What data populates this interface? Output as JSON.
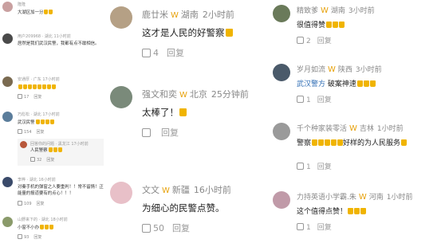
{
  "col1": [
    {
      "name": "隆隆",
      "text": "大湖区加一分",
      "emoji": 2,
      "likes": "",
      "reply": "",
      "avatar_color": "#c9a0a0"
    },
    {
      "name": "用户209968 · 湖北 11小时前",
      "text": "居然是我们武汉民警，我都有点不敢相信。",
      "emoji": 0,
      "likes": "",
      "reply": "",
      "avatar_color": "#4a4a4a"
    },
    {
      "name": "安通厚 · 广东 17小时前",
      "text": "",
      "emoji": 8,
      "likes": "17",
      "reply": "回复",
      "avatar_color": "#7a6a50"
    },
    {
      "name": "巧彪松 · 湖北 17小时前",
      "text": "武汉民警",
      "emoji": 4,
      "likes": "154",
      "reply": "回复",
      "avatar_color": "#5b7d9b",
      "sub": {
        "name": "回答你的问题 · 黑龙江 17小时前",
        "text": "人民警察",
        "emoji": 3,
        "likes": "32",
        "reply": "回复"
      }
    },
    {
      "name": "李桦 · 湖北 16小时前",
      "text": "对秦手机的弹窗之人要重判！！常不留情！正能量的报道要有的点心！！！",
      "emoji": 0,
      "likes": "109",
      "reply": "回复",
      "avatar_color": "#3a4a6a"
    },
    {
      "name": "山野来下的 · 湖北 18小时前",
      "text": "小窗不小办",
      "emoji": 3,
      "likes": "93",
      "reply": "回复",
      "avatar_color": "#8a9a6a"
    }
  ],
  "col2": [
    {
      "name": "鹿廿米",
      "region": "湖南",
      "time": "2小时前",
      "text": "这才是人民的好警察",
      "emoji": 1,
      "likes": "4",
      "reply": "回复",
      "avatar_color": "#b5a085"
    },
    {
      "name": "强文和奕",
      "region": "北京",
      "time": "25分钟前",
      "text": "太棒了！",
      "emoji": 1,
      "likes": "",
      "reply": "回复",
      "avatar_color": "#7a8a7a"
    },
    {
      "name": "文文",
      "region": "新疆",
      "time": "16小时前",
      "text": "为细心的民警点赞。",
      "emoji": 0,
      "likes": "50",
      "reply": "回复",
      "avatar_color": "#e8c0c8"
    }
  ],
  "col3": [
    {
      "name": "精致爹",
      "region": "湖南",
      "time": "3小时前",
      "pre": "",
      "text": "很值得赞",
      "emoji": 3,
      "likes": "2",
      "reply": "回复",
      "avatar_color": "#6a7a5a"
    },
    {
      "name": "岁月如流",
      "region": "陕西",
      "time": "3小时前",
      "pre": "武汉警方",
      "text": "破案神速",
      "emoji": 3,
      "likes": "1",
      "reply": "回复",
      "avatar_color": "#4a5a6a"
    },
    {
      "name": "千个种家装零活",
      "region": "吉林",
      "time": "1小时前",
      "pre": "",
      "text": "警察",
      "emoji": 5,
      "text2": "好样的为人民服务",
      "emoji2": 1,
      "likes": "1",
      "reply": "回复",
      "avatar_color": "#9a9a9a"
    },
    {
      "name": "力持英语小学霸.朱",
      "region": "河南",
      "time": "1小时前",
      "pre": "",
      "text": "这个值得点赞！",
      "emoji": 3,
      "likes": "1",
      "reply": "回复",
      "avatar_color": "#c09aa8"
    }
  ]
}
